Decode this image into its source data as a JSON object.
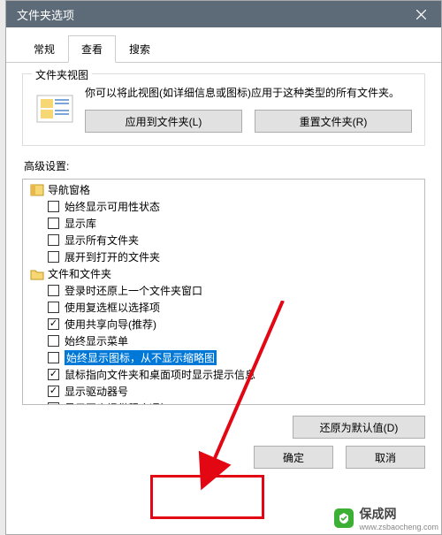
{
  "title": "文件夹选项",
  "tabs": {
    "general": "常规",
    "view": "查看",
    "search": "搜索"
  },
  "groupbox": {
    "label": "文件夹视图",
    "desc": "你可以将此视图(如详细信息或图标)应用于这种类型的所有文件夹。",
    "apply_btn": "应用到文件夹(L)",
    "reset_btn": "重置文件夹(R)"
  },
  "advanced_label": "高级设置:",
  "tree": {
    "cat_nav": "导航窗格",
    "opt_availability": "始终显示可用性状态",
    "opt_show_lib": "显示库",
    "opt_show_all_folders": "显示所有文件夹",
    "opt_expand_open": "展开到打开的文件夹",
    "cat_files": "文件和文件夹",
    "opt_restore_prev": "登录时还原上一个文件夹窗口",
    "opt_checkboxes": "使用复选框以选择项",
    "opt_sharing_wizard": "使用共享向导(推荐)",
    "opt_always_menu": "始终显示菜单",
    "opt_icons_no_thumbs": "始终显示图标，从不显示缩略图",
    "opt_tooltip": "鼠标指向文件夹和桌面项时显示提示信息",
    "opt_drive_letter": "显示驱动器号",
    "opt_sync_notify": "显示同步提供程序通知"
  },
  "reset_defaults": "还原为默认值(D)",
  "footer": {
    "ok": "确定",
    "cancel": "取消"
  },
  "watermark": {
    "site": "保成网",
    "url": "www.zsbaocheng.com"
  }
}
